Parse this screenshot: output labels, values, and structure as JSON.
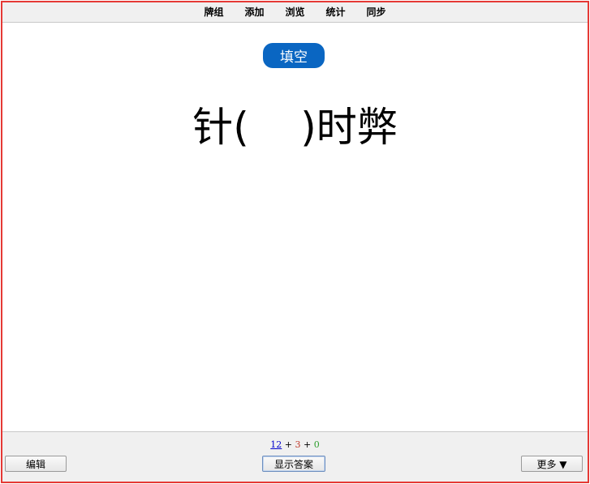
{
  "topbar": {
    "items": [
      {
        "label": "牌组"
      },
      {
        "label": "添加"
      },
      {
        "label": "浏览"
      },
      {
        "label": "统计"
      },
      {
        "label": "同步"
      }
    ]
  },
  "card": {
    "type_badge": "填空",
    "question": "针(    )时弊"
  },
  "colors": {
    "badge_bg": "#0a66c2",
    "border": "#e53935",
    "new_count": "#0000cc",
    "learn_count": "#c0392b",
    "review_count": "#2e9e2e"
  },
  "counts": {
    "new": "12",
    "separator1": " + ",
    "learning": "3",
    "separator2": " + ",
    "review": "0"
  },
  "bottombar": {
    "edit_label": "编辑",
    "show_answer_label": "显示答案",
    "more_label": "更多 ▼"
  }
}
